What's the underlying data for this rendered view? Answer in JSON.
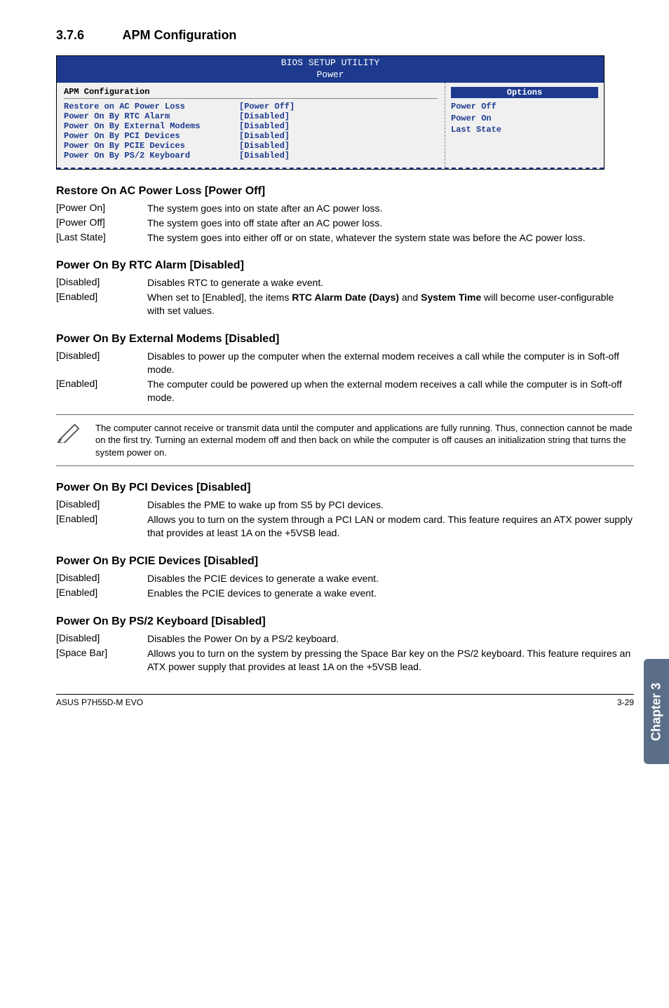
{
  "section": {
    "number": "3.7.6",
    "title": "APM Configuration"
  },
  "bios": {
    "util_title": "BIOS SETUP UTILITY",
    "util_tab": "Power",
    "group_heading": "APM Configuration",
    "rows": [
      {
        "label": "Restore on AC Power Loss",
        "value": "[Power Off]"
      },
      {
        "label": "Power On By RTC Alarm",
        "value": "[Disabled]"
      },
      {
        "label": "Power On By External Modems",
        "value": "[Disabled]"
      },
      {
        "label": "Power On By PCI Devices",
        "value": "[Disabled]"
      },
      {
        "label": "Power On By PCIE Devices",
        "value": "[Disabled]"
      },
      {
        "label": "Power On By PS/2 Keyboard",
        "value": "[Disabled]"
      }
    ],
    "options_label": "Options",
    "options": [
      "Power Off",
      "Power On",
      "Last State"
    ]
  },
  "items": {
    "restore": {
      "heading": "Restore On AC Power Loss [Power Off]",
      "defs": [
        {
          "term": "[Power On]",
          "desc": "The system goes into on state after an AC power loss."
        },
        {
          "term": "[Power Off]",
          "desc": "The system goes into off state after an AC power loss."
        },
        {
          "term": "[Last State]",
          "desc": "The system goes into either off or on state, whatever the system state was before the AC power loss."
        }
      ]
    },
    "rtc": {
      "heading": "Power On By RTC Alarm [Disabled]",
      "defs": [
        {
          "term": "[Disabled]",
          "desc": "Disables RTC to generate a wake event."
        },
        {
          "term": "[Enabled]",
          "desc_pre": "When set to [Enabled], the items ",
          "desc_bold1": "RTC Alarm Date (Days)",
          "desc_mid": " and ",
          "desc_bold2": "System Time",
          "desc_post": " will become user-configurable with set values."
        }
      ]
    },
    "modems": {
      "heading": "Power On By External Modems [Disabled]",
      "defs": [
        {
          "term": "[Disabled]",
          "desc": "Disables to power up the computer when the external modem receives a call while the computer is in Soft-off mode."
        },
        {
          "term": "[Enabled]",
          "desc": "The computer could be powered up when the external modem receives a call while the computer is in Soft-off mode."
        }
      ]
    },
    "note": "The computer cannot receive or transmit data until the computer and applications are fully running. Thus, connection cannot be made on the first try. Turning an external modem off and then back on while the computer is off causes an initialization string that turns the system power on.",
    "pci": {
      "heading": "Power On By PCI Devices [Disabled]",
      "defs": [
        {
          "term": "[Disabled]",
          "desc": "Disables the PME to wake up from S5 by PCI devices."
        },
        {
          "term": "[Enabled]",
          "desc": "Allows you to turn on the system through a PCI LAN or modem card. This feature requires an ATX power supply that provides at least 1A on the +5VSB lead."
        }
      ]
    },
    "pcie": {
      "heading": "Power On By PCIE Devices [Disabled]",
      "defs": [
        {
          "term": "[Disabled]",
          "desc": "Disables the PCIE devices to generate a wake event."
        },
        {
          "term": "[Enabled]",
          "desc": "Enables the PCIE devices to generate a wake event."
        }
      ]
    },
    "ps2": {
      "heading": "Power On By PS/2 Keyboard [Disabled]",
      "defs": [
        {
          "term": "[Disabled]",
          "desc": "Disables the Power On by a PS/2 keyboard."
        },
        {
          "term": "[Space Bar]",
          "desc": "Allows you to turn on the system by pressing the Space Bar key on the PS/2 keyboard. This feature requires an ATX power supply that provides at least 1A on the +5VSB lead."
        }
      ]
    }
  },
  "sidetab": "Chapter 3",
  "footer": {
    "left": "ASUS P7H55D-M EVO",
    "right": "3-29"
  }
}
